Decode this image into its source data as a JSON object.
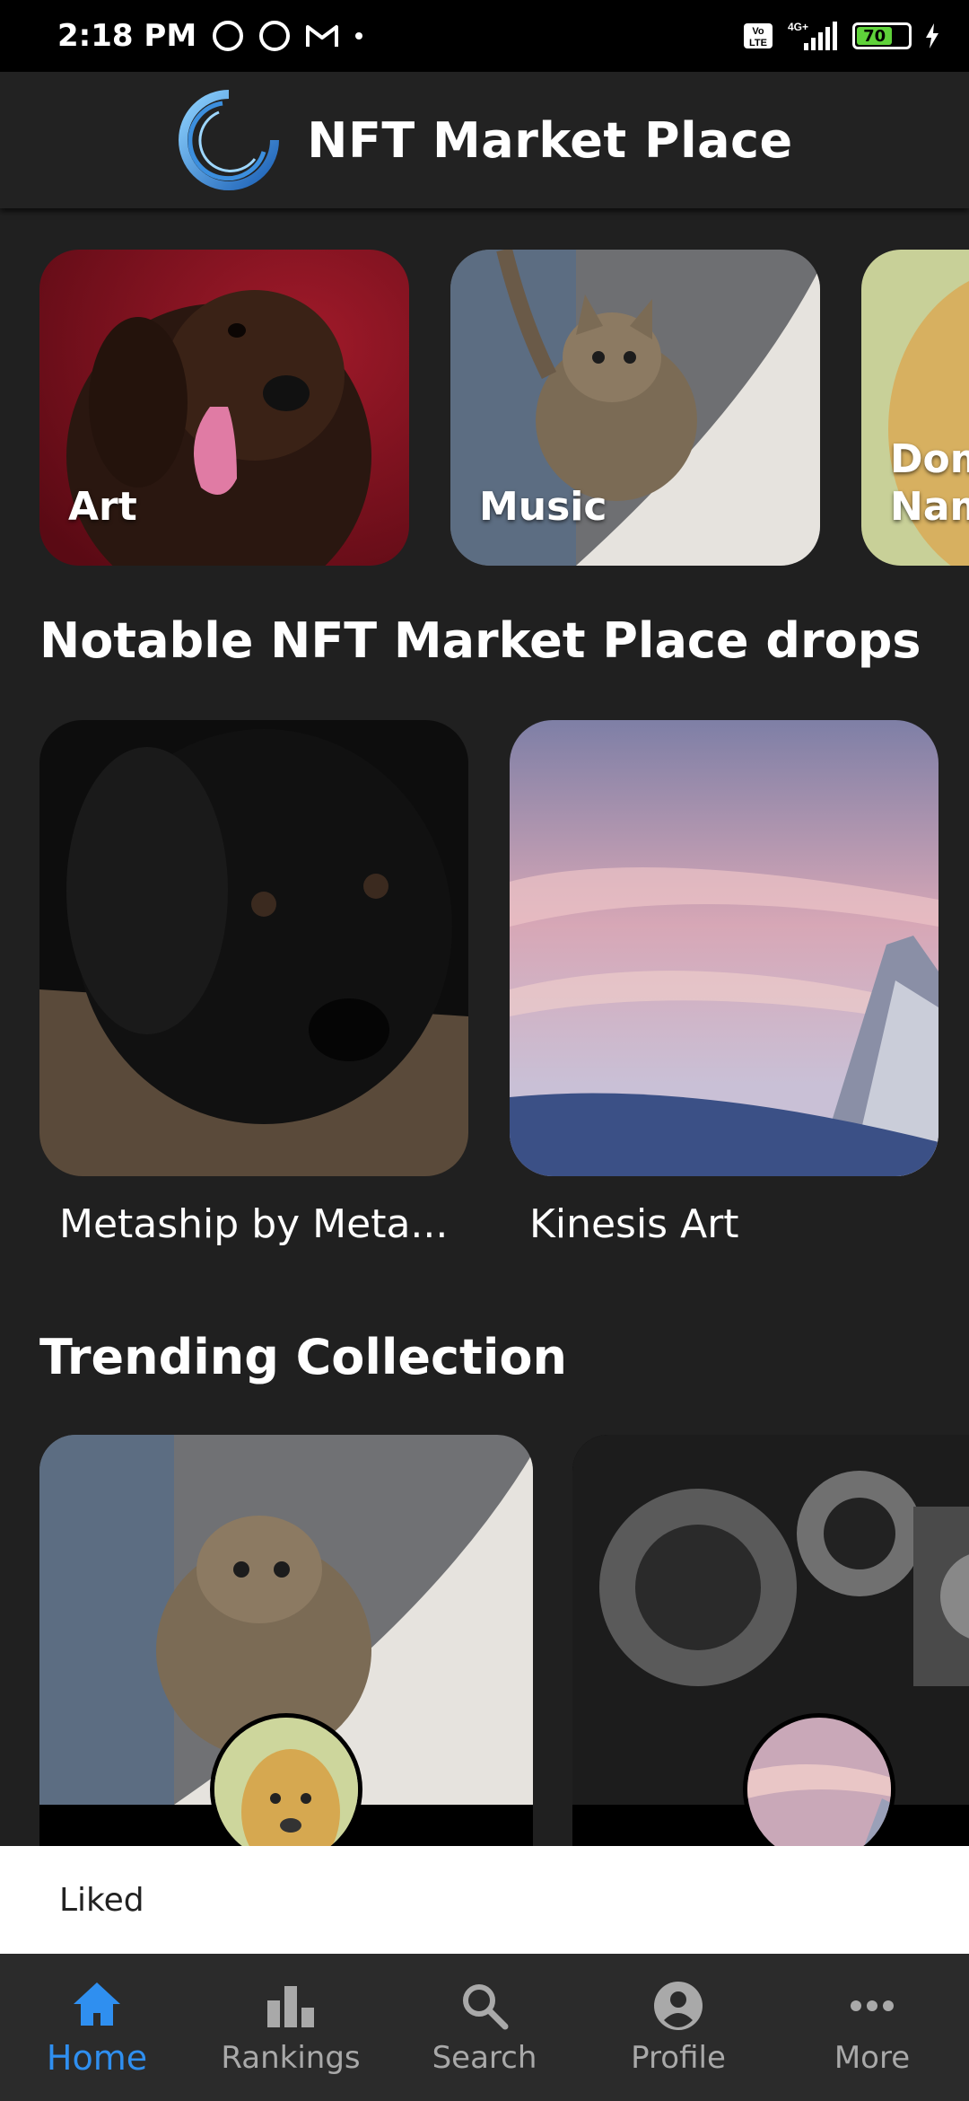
{
  "status_bar": {
    "time": "2:18 PM",
    "network": "4G+",
    "battery": "70"
  },
  "app_bar": {
    "title": "NFT Market Place"
  },
  "categories": [
    {
      "label": "Art"
    },
    {
      "label": "Music"
    },
    {
      "label": "Dom Nam"
    }
  ],
  "sections": {
    "drops_title": "Notable NFT Market Place drops",
    "trending_title": "Trending Collection"
  },
  "drops": [
    {
      "label": "Metaship by Meta..."
    },
    {
      "label": "Kinesis Art"
    }
  ],
  "snackbar": {
    "message": "Liked"
  },
  "bottom_nav": {
    "items": [
      {
        "label": "Home",
        "icon": "home-icon",
        "active": true
      },
      {
        "label": "Rankings",
        "icon": "bar-chart-icon",
        "active": false
      },
      {
        "label": "Search",
        "icon": "search-icon",
        "active": false
      },
      {
        "label": "Profile",
        "icon": "account-circle-icon",
        "active": false
      },
      {
        "label": "More",
        "icon": "more-horiz-icon",
        "active": false
      }
    ],
    "active_color": "#2f8ff0",
    "inactive_color": "#a9a9a9"
  }
}
